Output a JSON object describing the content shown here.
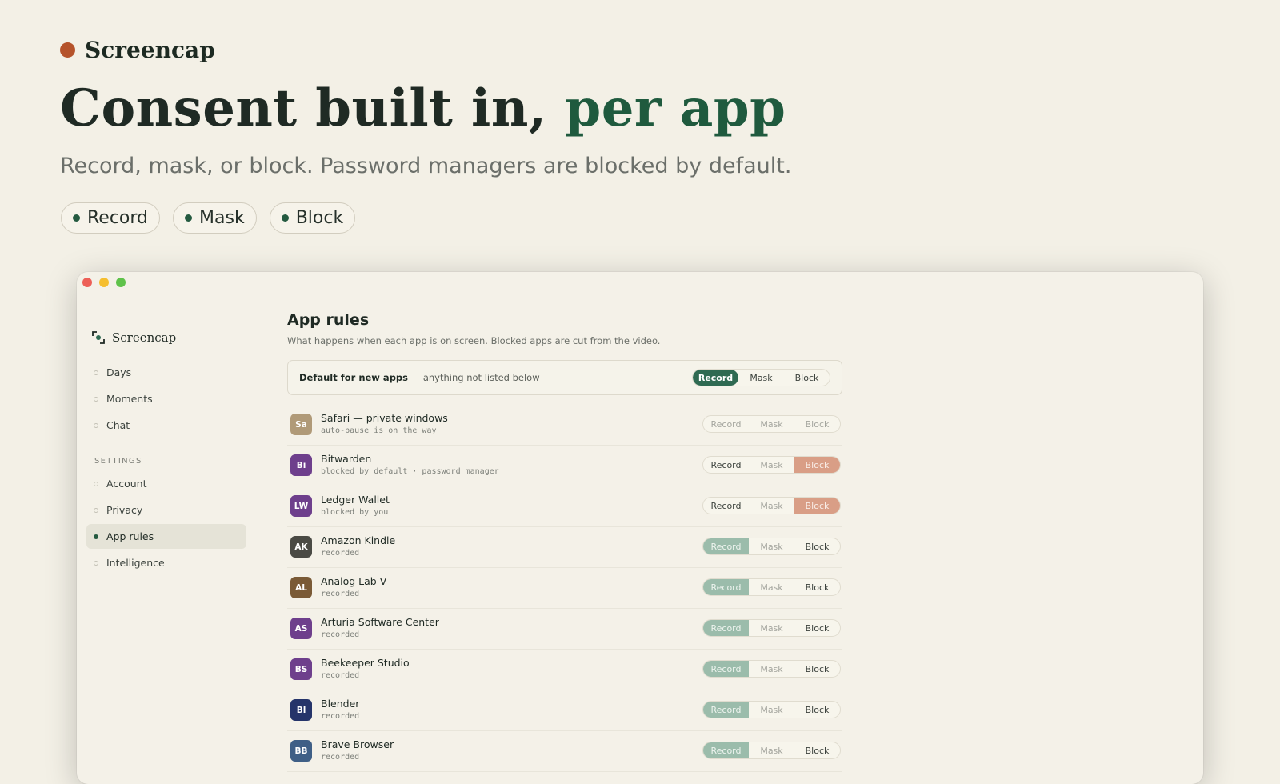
{
  "hero": {
    "brand": "Screencap",
    "headline_main": "Consent built in, ",
    "headline_accent": "per app",
    "subhead": "Record, mask, or block. Password managers are blocked by default.",
    "pills": [
      "Record",
      "Mask",
      "Block"
    ]
  },
  "colors": {
    "background": "#f3f0e6",
    "accent_green": "#245a40",
    "brand_dot": "#b5532b",
    "record_active": "#2f6a52",
    "block_active": "#d99e86"
  },
  "sidebar": {
    "brand": "Screencap",
    "nav": [
      "Days",
      "Moments",
      "Chat"
    ],
    "settings_heading": "SETTINGS",
    "settings": [
      "Account",
      "Privacy",
      "App rules",
      "Intelligence"
    ],
    "active_item": "App rules"
  },
  "main": {
    "title": "App rules",
    "subtitle": "What happens when each app is on screen. Blocked apps are cut from the video.",
    "default_row": {
      "label_bold": "Default for new apps",
      "label_rest": " — anything not listed below",
      "selected": "Record"
    },
    "segment_labels": [
      "Record",
      "Mask",
      "Block"
    ],
    "apps": [
      {
        "initials": "Sa",
        "name": "Safari — private windows",
        "meta": "auto-pause is on the way",
        "selected": "none",
        "color": "#b09a78"
      },
      {
        "initials": "Bi",
        "name": "Bitwarden",
        "meta": "blocked by default · password manager",
        "selected": "Block",
        "color": "#6e3f8c"
      },
      {
        "initials": "LW",
        "name": "Ledger Wallet",
        "meta": "blocked by you",
        "selected": "Block",
        "color": "#6e3f8c"
      },
      {
        "initials": "AK",
        "name": "Amazon Kindle",
        "meta": "recorded",
        "selected": "Record",
        "color": "#4a4a44"
      },
      {
        "initials": "AL",
        "name": "Analog Lab V",
        "meta": "recorded",
        "selected": "Record",
        "color": "#7a5a36"
      },
      {
        "initials": "AS",
        "name": "Arturia Software Center",
        "meta": "recorded",
        "selected": "Record",
        "color": "#6e3f8c"
      },
      {
        "initials": "BS",
        "name": "Beekeeper Studio",
        "meta": "recorded",
        "selected": "Record",
        "color": "#6e3f8c"
      },
      {
        "initials": "Bl",
        "name": "Blender",
        "meta": "recorded",
        "selected": "Record",
        "color": "#25346a"
      },
      {
        "initials": "BB",
        "name": "Brave Browser",
        "meta": "recorded",
        "selected": "Record",
        "color": "#3f5f86"
      }
    ]
  }
}
